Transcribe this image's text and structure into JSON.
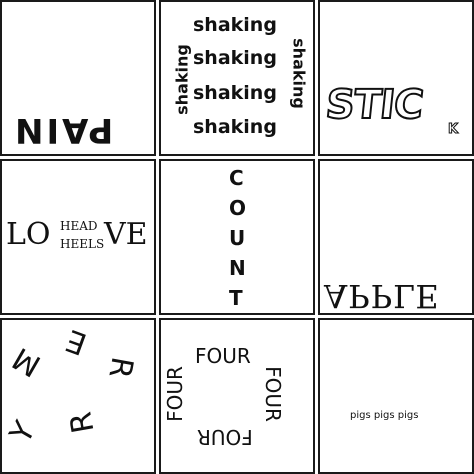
{
  "colors": {
    "border": "#1a1a1a",
    "ink": "#111111",
    "background": "#ffffff"
  },
  "puzzles": {
    "pain": {
      "text": "PAIN"
    },
    "shaking": {
      "word": "shaking",
      "left": "shaking",
      "right": "shaking",
      "rows": [
        "shaking",
        "shaking",
        "shaking",
        "shaking"
      ]
    },
    "stick": {
      "big": "STIC",
      "small": "K"
    },
    "love": {
      "lo": "LO",
      "head": "HEAD",
      "heels": "HEELS",
      "ve": "VE"
    },
    "count": {
      "letters": [
        "C",
        "O",
        "U",
        "N",
        "T"
      ]
    },
    "apple": {
      "text": "APPLE"
    },
    "merry": {
      "letters": [
        "M",
        "E",
        "R",
        "R",
        "Y"
      ]
    },
    "four": {
      "top": "FOUR",
      "right": "FOUR",
      "bottom": "FOUR",
      "left": "FOUR"
    },
    "pigs": {
      "text": "pigs pigs pigs"
    }
  }
}
